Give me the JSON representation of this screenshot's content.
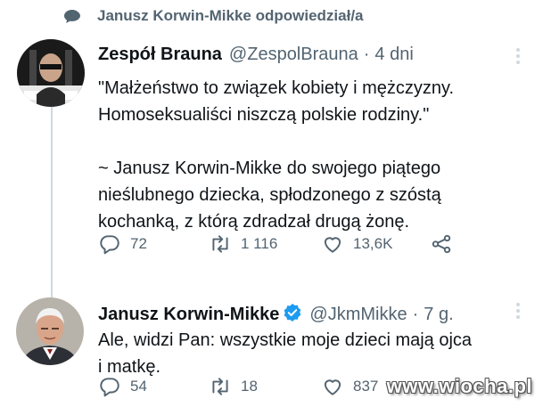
{
  "colors": {
    "text_primary": "#0f1419",
    "text_secondary": "#536471",
    "thread_line": "#cfd9de",
    "verified_badge": "#1d9bf0"
  },
  "reply_context": {
    "icon": "reply-bubble-icon",
    "text": "Janusz Korwin-Mikke odpowiedział/a"
  },
  "tweets": [
    {
      "name": "Zespół Brauna",
      "handle": "@ZespolBrauna",
      "separator": "·",
      "time": "4 dni",
      "verified": false,
      "text": "\"Małżeństwo to związek kobiety i mężczyzny.\nHomoseksualiści niszczą polskie rodziny.\"\n\n~ Janusz Korwin-Mikke do swojego piątego\nnieślubnego dziecka, spłodzonego z szóstą\nkochanką, z którą zdradzał drugą żonę.",
      "actions": {
        "replies": "72",
        "retweets": "1 116",
        "likes": "13,6K"
      }
    },
    {
      "name": "Janusz Korwin-Mikke",
      "handle": "@JkmMikke",
      "separator": "·",
      "time": "7 g.",
      "verified": true,
      "text": "Ale, widzi Pan: wszystkie moje dzieci mają ojca\ni matkę.",
      "actions": {
        "replies": "54",
        "retweets": "18",
        "likes": "837"
      }
    }
  ],
  "watermark": "www.wiocha.pl"
}
